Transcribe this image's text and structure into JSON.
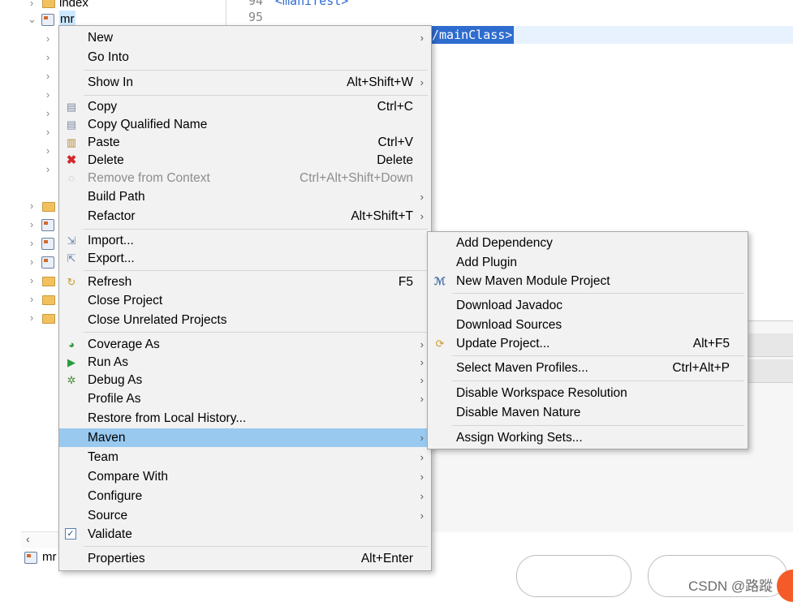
{
  "editor": {
    "line_94": "94",
    "line_94_code": "<manifest>",
    "line_95": "95",
    "selected_code": "/mainClass>"
  },
  "tree": {
    "item_index": "index",
    "item_mr": "mr",
    "bottom_label": "mr"
  },
  "context_menu": {
    "items": [
      {
        "label": "New",
        "accel": ""
      },
      {
        "label": "Go Into",
        "accel": ""
      },
      {
        "label": "Show In",
        "accel": "Alt+Shift+W"
      },
      {
        "label": "Copy",
        "accel": "Ctrl+C"
      },
      {
        "label": "Copy Qualified Name",
        "accel": ""
      },
      {
        "label": "Paste",
        "accel": "Ctrl+V"
      },
      {
        "label": "Delete",
        "accel": "Delete"
      },
      {
        "label": "Remove from Context",
        "accel": "Ctrl+Alt+Shift+Down"
      },
      {
        "label": "Build Path",
        "accel": ""
      },
      {
        "label": "Refactor",
        "accel": "Alt+Shift+T"
      },
      {
        "label": "Import...",
        "accel": ""
      },
      {
        "label": "Export...",
        "accel": ""
      },
      {
        "label": "Refresh",
        "accel": "F5"
      },
      {
        "label": "Close Project",
        "accel": ""
      },
      {
        "label": "Close Unrelated Projects",
        "accel": ""
      },
      {
        "label": "Coverage As",
        "accel": ""
      },
      {
        "label": "Run As",
        "accel": ""
      },
      {
        "label": "Debug As",
        "accel": ""
      },
      {
        "label": "Profile As",
        "accel": ""
      },
      {
        "label": "Restore from Local History...",
        "accel": ""
      },
      {
        "label": "Maven",
        "accel": ""
      },
      {
        "label": "Team",
        "accel": ""
      },
      {
        "label": "Compare With",
        "accel": ""
      },
      {
        "label": "Configure",
        "accel": ""
      },
      {
        "label": "Source",
        "accel": ""
      },
      {
        "label": "Validate",
        "accel": ""
      },
      {
        "label": "Properties",
        "accel": "Alt+Enter"
      }
    ]
  },
  "maven_menu": {
    "items": [
      {
        "label": "Add Dependency",
        "accel": ""
      },
      {
        "label": "Add Plugin",
        "accel": ""
      },
      {
        "label": "New Maven Module Project",
        "accel": ""
      },
      {
        "label": "Download Javadoc",
        "accel": ""
      },
      {
        "label": "Download Sources",
        "accel": ""
      },
      {
        "label": "Update Project...",
        "accel": "Alt+F5"
      },
      {
        "label": "Select Maven Profiles...",
        "accel": "Ctrl+Alt+P"
      },
      {
        "label": "Disable Workspace Resolution",
        "accel": ""
      },
      {
        "label": "Disable Maven Nature",
        "accel": ""
      },
      {
        "label": "Assign Working Sets...",
        "accel": ""
      }
    ]
  },
  "watermark": "CSDN @路蹤",
  "colors": {
    "menu_bg": "#f2f2f2",
    "highlight": "#99c9ef",
    "selection": "#2f6ccf"
  }
}
